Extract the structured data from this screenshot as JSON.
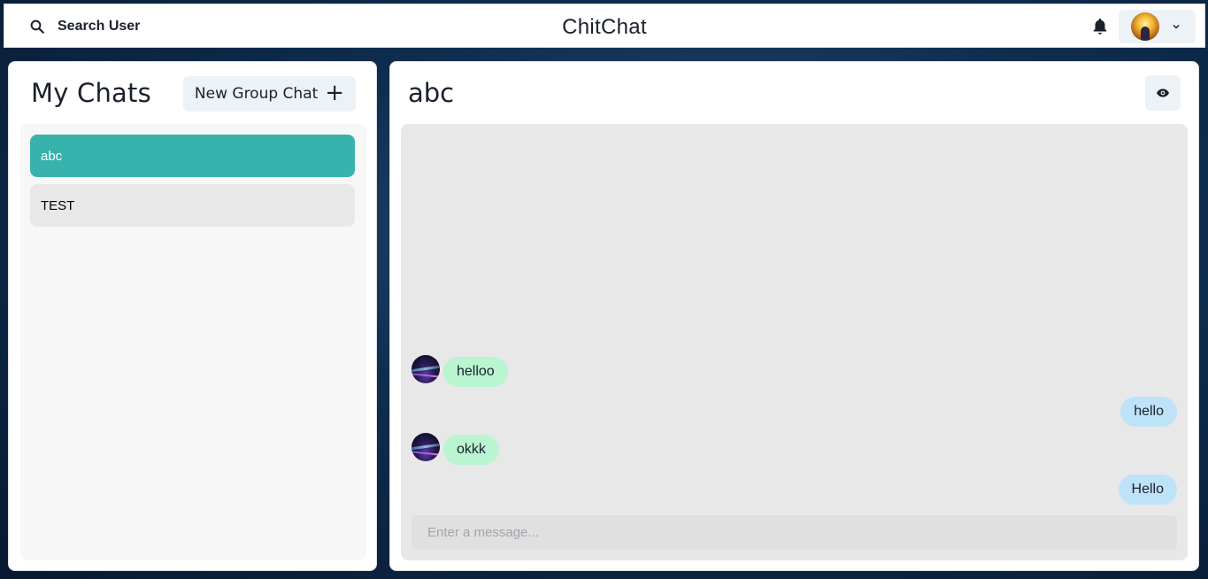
{
  "header": {
    "search_label": "Search User",
    "app_title": "ChitChat",
    "icons": {
      "search": "search-icon",
      "bell": "bell-icon",
      "profile_chevron": "chevron-down-icon"
    }
  },
  "sidebar": {
    "title": "My Chats",
    "new_group_label": "New Group Chat",
    "new_group_icon": "+",
    "chats": [
      {
        "name": "abc",
        "active": true
      },
      {
        "name": "TEST",
        "active": false
      }
    ]
  },
  "chat": {
    "title": "abc",
    "messages": [
      {
        "text": "helloo",
        "direction": "incoming",
        "has_avatar": true
      },
      {
        "text": "hello",
        "direction": "outgoing",
        "has_avatar": false
      },
      {
        "text": "okkk",
        "direction": "incoming",
        "has_avatar": true
      },
      {
        "text": "Hello",
        "direction": "outgoing",
        "has_avatar": false
      }
    ],
    "input_placeholder": "Enter a message...",
    "input_value": ""
  },
  "colors": {
    "active_chat": "#38b2ac",
    "incoming_bubble": "#b9f5d0",
    "outgoing_bubble": "#bee3f8",
    "button_bg": "#edf2f7"
  }
}
